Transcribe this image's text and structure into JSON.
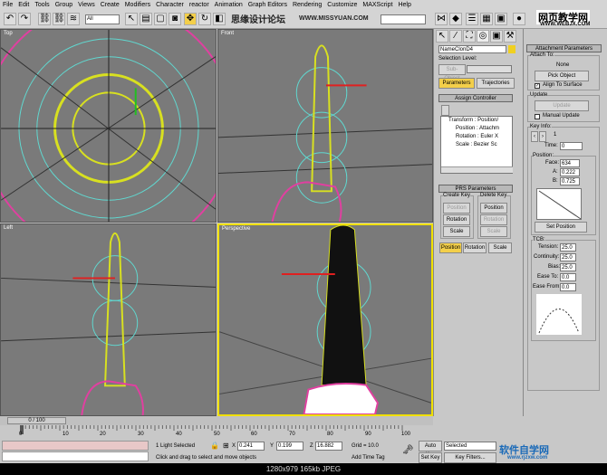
{
  "menu": [
    "File",
    "Edit",
    "Tools",
    "Group",
    "Views",
    "Create",
    "Modifiers",
    "Character",
    "reactor",
    "Animation",
    "Graph Editors",
    "Rendering",
    "Customize",
    "MAXScript",
    "Help"
  ],
  "toolbar": {
    "selection_filter": "All"
  },
  "watermarks": {
    "top_cn": "思缘设计论坛",
    "top_url": "WWW.MISSYUAN.COM",
    "top_right_cn": "网页教学网",
    "top_right_url": "WWW.WEBJX.COM",
    "bottom_cn": "软件自学网",
    "bottom_url": "www.rjzxw.com"
  },
  "viewports": {
    "top": "Top",
    "front": "Front",
    "left": "Left",
    "perspective": "Perspective"
  },
  "command_panel": {
    "object_name": "NameClonD4",
    "selection_level": "Selection Level:",
    "sub_object": "Sub-Object",
    "tabs": [
      "Parameters",
      "Trajectories"
    ],
    "assign_controller": "Assign Controller",
    "tree": [
      "Transform : Position/",
      "Position : Attachm",
      "Rotation : Euler X",
      "Scale : Bezier Sc"
    ],
    "prs_parameters": "PRS Parameters",
    "create_key": "Create Key",
    "delete_key": "Delete Key",
    "create_buttons": [
      "Position",
      "Rotation",
      "Scale"
    ],
    "delete_buttons": [
      "Position",
      "Rotation",
      "Scale"
    ],
    "mode_buttons": [
      "Position",
      "Rotation",
      "Scale"
    ]
  },
  "attachment": {
    "title": "Attachment Parameters",
    "attach_to": "Attach To:",
    "target": "None",
    "pick_object": "Pick Object",
    "align_to_surface": "Align To Surface",
    "update_group": "Update",
    "update_btn": "Update",
    "manual_update": "Manual Update",
    "key_info": "Key Info:",
    "key_number": "1",
    "time_label": "Time:",
    "time": "0",
    "position_group": "Position:",
    "face_label": "Face:",
    "face": "634",
    "a_label": "A:",
    "a": "0.222",
    "b_label": "B:",
    "b": "0.725",
    "set_position": "Set Position",
    "tcb": "TCB:",
    "tension_label": "Tension:",
    "tension": "25.0",
    "continuity_label": "Continuity:",
    "continuity": "25.0",
    "bias_label": "Bias:",
    "bias": "25.0",
    "ease_to_label": "Ease To:",
    "ease_to": "0.0",
    "ease_from_label": "Ease From:",
    "ease_from": "0.0"
  },
  "timeline": {
    "frame": "0 / 100",
    "ticks": [
      "0",
      "10",
      "20",
      "30",
      "40",
      "50",
      "60",
      "70",
      "80",
      "90",
      "100"
    ],
    "progress": 0
  },
  "status": {
    "selected": "1 Light Selected",
    "x_label": "X",
    "x": "0.241",
    "y_label": "Y",
    "y": "0.199",
    "z_label": "Z",
    "z": "16.882",
    "grid": "Grid = 10.0",
    "prompt": "Click and drag to select and move objects",
    "add_time_tag": "Add Time Tag",
    "auto_key": "Auto Key",
    "set_key": "Set Key",
    "key_mode": "Selected",
    "key_filters": "Key Filters..."
  },
  "caption": "1280x979  165kb  JPEG"
}
